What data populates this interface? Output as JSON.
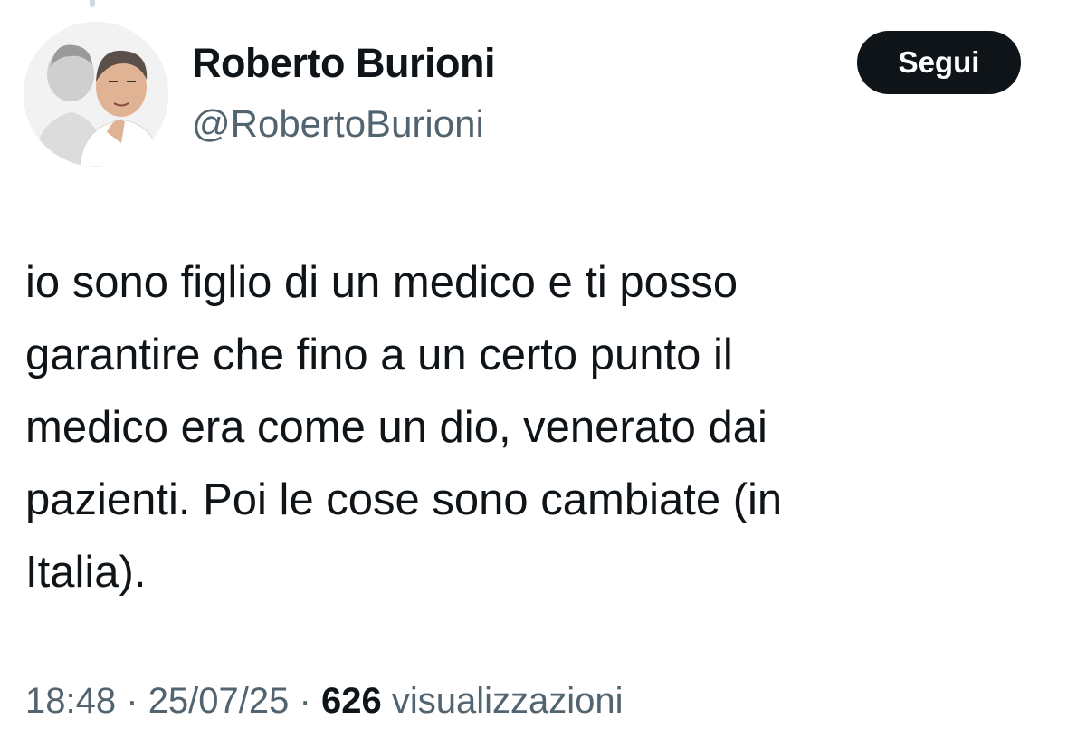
{
  "tweet": {
    "author": {
      "name": "Roberto Burioni",
      "handle": "@RobertoBurioni"
    },
    "follow_label": "Segui",
    "text_lines": [
      "io sono figlio di un medico e ti posso",
      "garantire che fino a un certo punto il",
      "medico era come un dio, venerato dai",
      "pazienti. Poi le cose sono cambiate (in",
      "Italia)."
    ],
    "meta": {
      "time": "18:48",
      "separator": "·",
      "date": "25/07/25",
      "views_count": "626",
      "views_label": "visualizzazioni"
    }
  },
  "colors": {
    "text_primary": "#0f1419",
    "text_secondary": "#536471",
    "button_bg": "#0f1419",
    "button_text": "#ffffff"
  }
}
